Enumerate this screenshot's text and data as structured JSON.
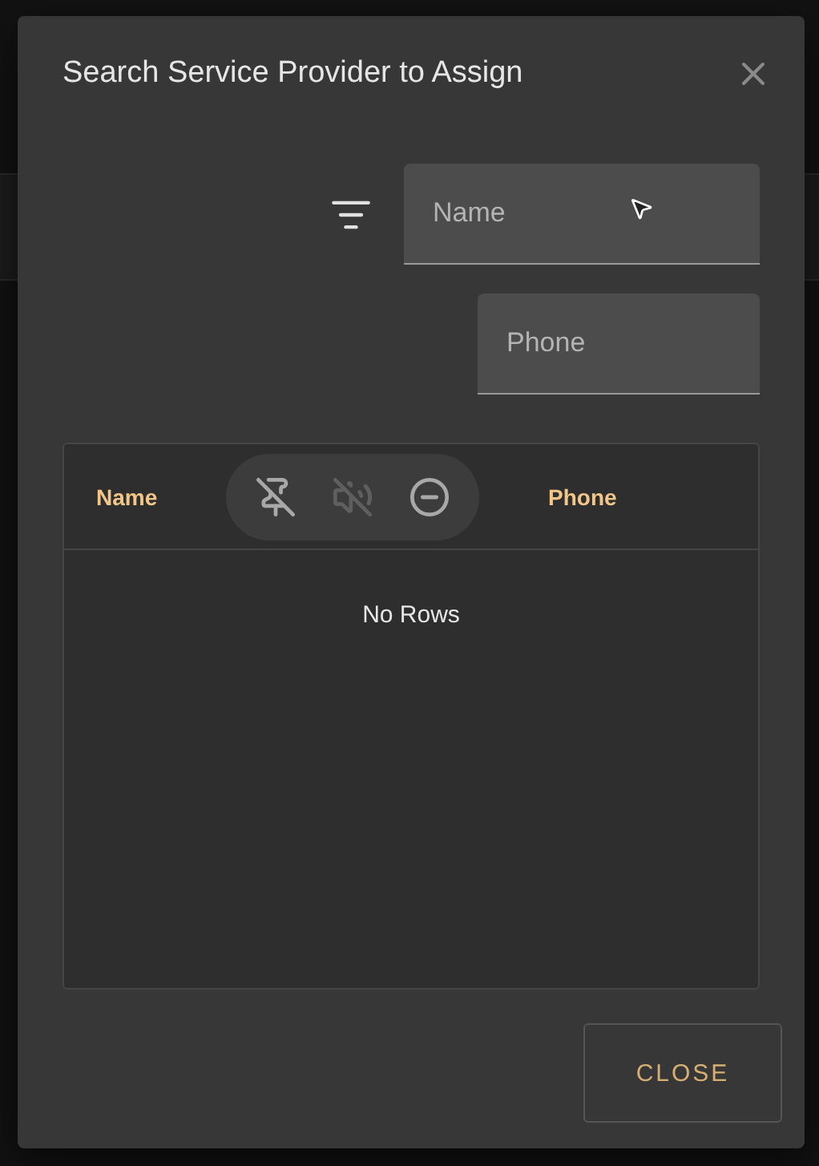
{
  "dialog": {
    "title": "Search Service Provider to Assign",
    "filters": [
      {
        "placeholder": "Name"
      },
      {
        "placeholder": "Phone"
      }
    ],
    "table": {
      "columns": [
        {
          "label": "Name"
        },
        {
          "label": "Phone"
        }
      ],
      "column_tools": [
        {
          "kind": "unpin",
          "disabled": false
        },
        {
          "kind": "mute",
          "disabled": true
        },
        {
          "kind": "remove",
          "disabled": false
        }
      ],
      "empty_text": "No Rows"
    },
    "buttons": [
      "CLOSE"
    ]
  }
}
